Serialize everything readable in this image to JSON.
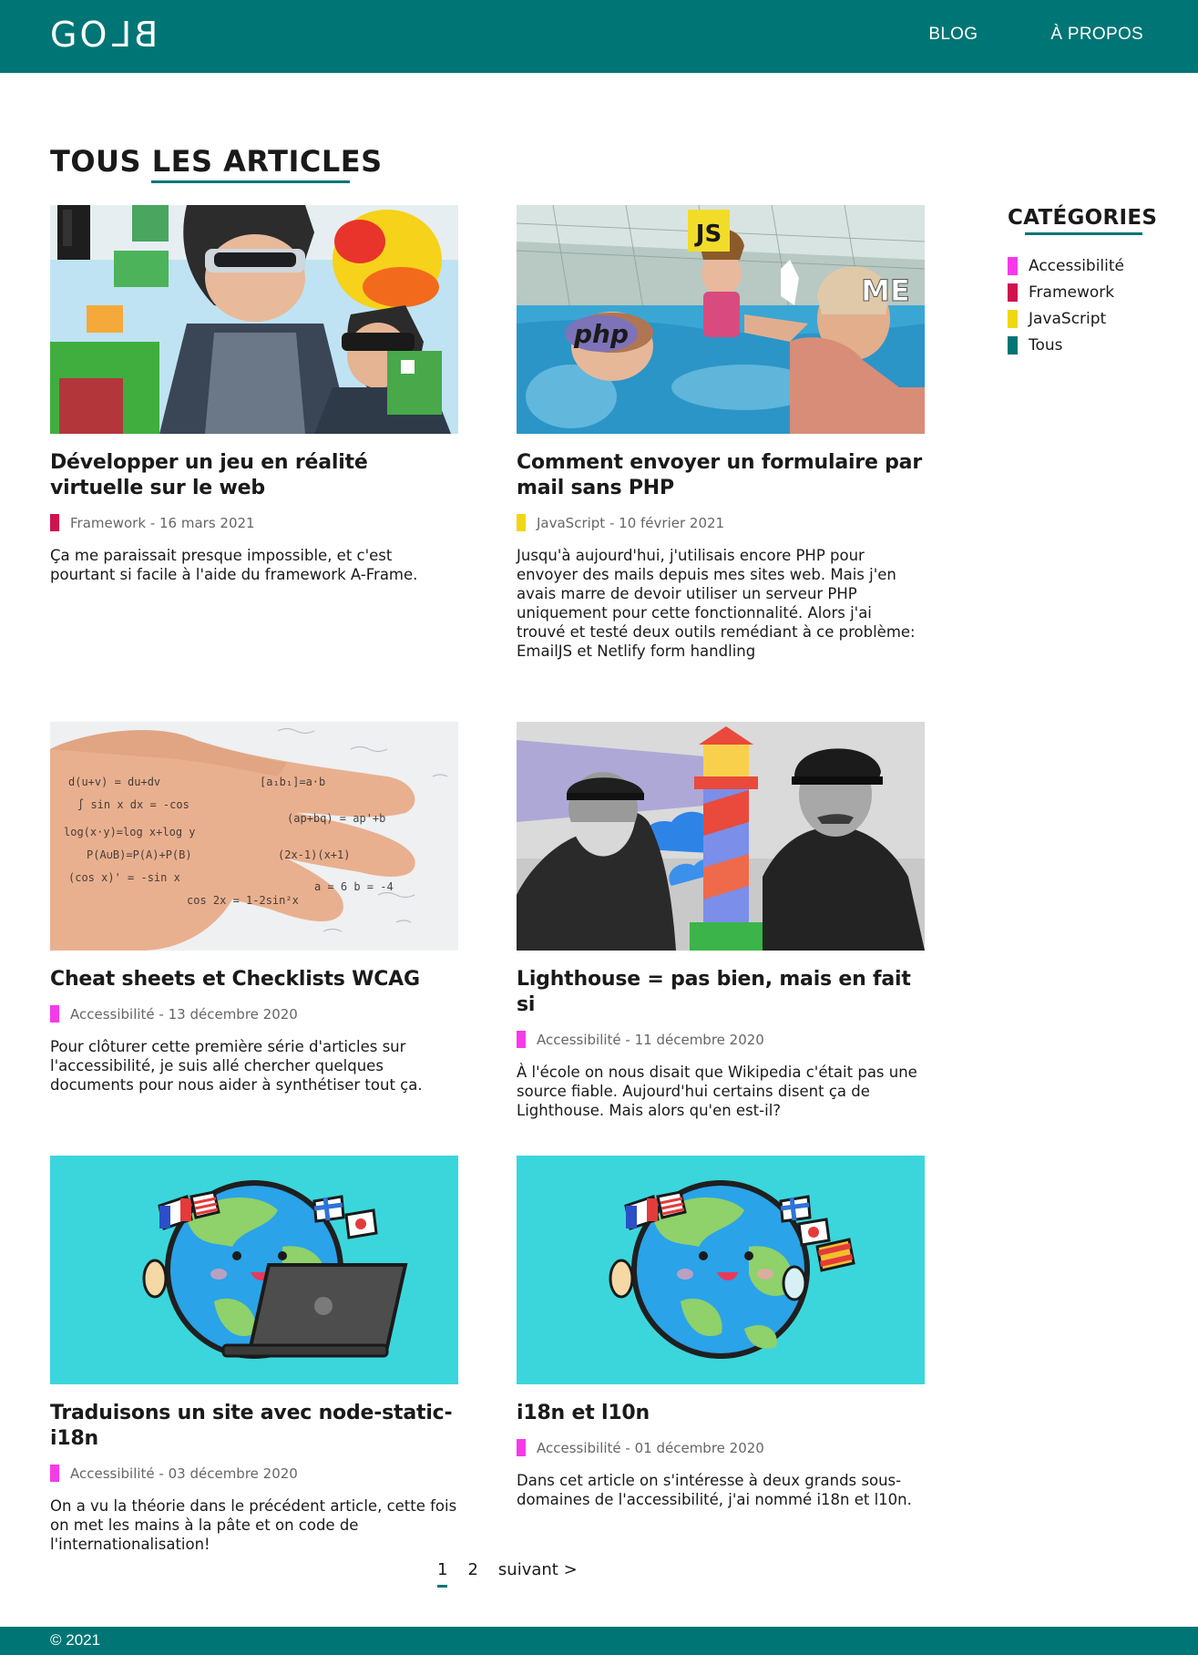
{
  "header": {
    "logo_left": "GO",
    "logo_right": "BL",
    "nav": [
      "BLOG",
      "À PROPOS"
    ]
  },
  "page_title": "TOUS LES ARTICLES",
  "articles": [
    {
      "title": "Développer un jeu en réalité virtuelle sur le web",
      "category": "Framework",
      "category_color": "#d0134f",
      "date": "16 mars 2021",
      "excerpt": "Ça me paraissait presque impossible, et c'est pourtant si facile à l'aide du framework A-Frame.",
      "image": "vr-headset-image"
    },
    {
      "title": "Comment envoyer un formulaire par mail sans PHP",
      "category": "JavaScript",
      "category_color": "#efd715",
      "date": "10 février 2021",
      "excerpt": "Jusqu'à aujourd'hui, j'utilisais encore PHP pour envoyer des mails depuis mes sites web. Mais j'en avais marre de devoir utiliser un serveur PHP uniquement pour cette fonctionnalité. Alors j'ai trouvé et testé deux outils remédiant à ce problème: EmailJS et Netlify form handling",
      "image": "pool-meme-image",
      "image_labels": [
        "JS",
        "ME",
        "php"
      ]
    },
    {
      "title": "Cheat sheets et Checklists WCAG",
      "category": "Accessibilité",
      "category_color": "#f73ae8",
      "date": "13 décembre 2020",
      "excerpt": "Pour clôturer cette première série d'articles sur l'accessibilité, je suis allé chercher quelques documents pour nous aider à synthétiser tout ça.",
      "image": "hand-notes-image"
    },
    {
      "title": "Lighthouse = pas bien, mais en fait si",
      "category": "Accessibilité",
      "category_color": "#f73ae8",
      "date": "11 décembre 2020",
      "excerpt": "À l'école on nous disait que Wikipedia c'était pas une source fiable. Aujourd'hui certains disent ça de Lighthouse. Mais alors qu'en est-il?",
      "image": "lighthouse-image"
    },
    {
      "title": "Traduisons un site avec node-static-i18n",
      "category": "Accessibilité",
      "category_color": "#f73ae8",
      "date": "03 décembre 2020",
      "excerpt": "On a vu la théorie dans le précédent article, cette fois on met les mains à la pâte et on code de l'internationalisation!",
      "image": "globe-laptop-image"
    },
    {
      "title": "i18n et l10n",
      "category": "Accessibilité",
      "category_color": "#f73ae8",
      "date": "01 décembre 2020",
      "excerpt": "Dans cet article on s'intéresse à deux grands sous-domaines de l'accessibilité, j'ai nommé i18n et l10n.",
      "image": "globe-flags-image"
    }
  ],
  "sidebar": {
    "title": "CATÉGORIES",
    "categories": [
      {
        "label": "Accessibilité",
        "color": "#f73ae8"
      },
      {
        "label": "Framework",
        "color": "#d0134f"
      },
      {
        "label": "JavaScript",
        "color": "#efd715"
      },
      {
        "label": "Tous",
        "color": "#007575"
      }
    ]
  },
  "pagination": {
    "pages": [
      "1",
      "2"
    ],
    "current": "1",
    "next_label": "suivant >"
  },
  "footer": {
    "copyright": "© 2021"
  },
  "theme": {
    "primary": "#007575"
  }
}
